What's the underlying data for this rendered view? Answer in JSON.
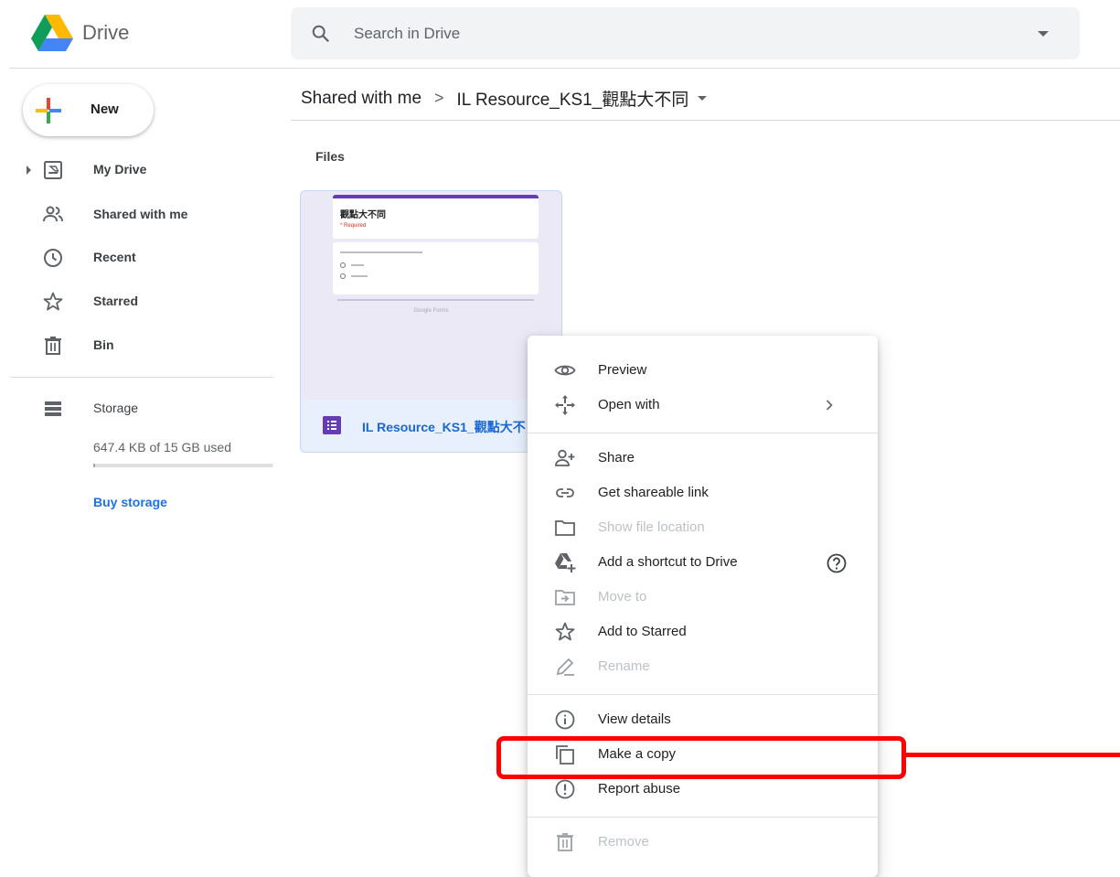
{
  "app": {
    "title": "Drive"
  },
  "search": {
    "placeholder": "Search in Drive"
  },
  "sidebar": {
    "new_label": "New",
    "items": [
      {
        "label": "My Drive",
        "icon": "my-drive-icon"
      },
      {
        "label": "Shared with me",
        "icon": "shared-icon"
      },
      {
        "label": "Recent",
        "icon": "clock-icon"
      },
      {
        "label": "Starred",
        "icon": "star-icon"
      },
      {
        "label": "Bin",
        "icon": "bin-icon"
      }
    ],
    "storage": {
      "label": "Storage",
      "used": "647.4 KB of 15 GB used",
      "used_fraction": 0.01,
      "buy_label": "Buy storage"
    }
  },
  "breadcrumb": {
    "parent": "Shared with me",
    "separator": ">",
    "current": "IL Resource_KS1_觀點大不同"
  },
  "files": {
    "section_label": "Files",
    "items": [
      {
        "name": "IL Resource_KS1_觀點大不",
        "thumb_title": "觀點大不同",
        "thumb_required": "* Required",
        "thumb_footer": "Google Forms"
      }
    ]
  },
  "context_menu": {
    "items": [
      {
        "label": "Preview",
        "icon": "eye-icon",
        "enabled": true
      },
      {
        "label": "Open with",
        "icon": "move-arrows-icon",
        "enabled": true,
        "submenu": true
      },
      {
        "label": "Share",
        "icon": "add-person-icon",
        "enabled": true
      },
      {
        "label": "Get shareable link",
        "icon": "link-icon",
        "enabled": true
      },
      {
        "label": "Show file location",
        "icon": "folder-icon",
        "enabled": false
      },
      {
        "label": "Add a shortcut to Drive",
        "icon": "drive-shortcut-icon",
        "enabled": true,
        "help": true
      },
      {
        "label": "Move to",
        "icon": "move-to-icon",
        "enabled": false
      },
      {
        "label": "Add to Starred",
        "icon": "star-icon",
        "enabled": true
      },
      {
        "label": "Rename",
        "icon": "pencil-icon",
        "enabled": false
      },
      {
        "label": "View details",
        "icon": "info-icon",
        "enabled": true
      },
      {
        "label": "Make a copy",
        "icon": "copy-icon",
        "enabled": true
      },
      {
        "label": "Report abuse",
        "icon": "alert-icon",
        "enabled": true
      },
      {
        "label": "Remove",
        "icon": "trash-icon",
        "enabled": false
      }
    ]
  },
  "colors": {
    "accent": "#1a73e8",
    "forms_purple": "#673ab7",
    "highlight": "#ff0000"
  }
}
